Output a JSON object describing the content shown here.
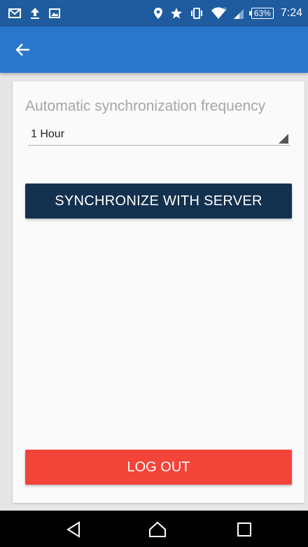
{
  "status_bar": {
    "left_icons": [
      "gmail-icon",
      "upload-icon",
      "image-icon"
    ],
    "right_icons": [
      "location-icon",
      "star-icon",
      "vibrate-icon",
      "wifi-icon",
      "signal-icon"
    ],
    "battery": "63%",
    "time": "7:24",
    "background": "#1f5c9f"
  },
  "app_bar": {
    "back_icon": "arrow-left-icon",
    "background": "#2a76cb"
  },
  "settings": {
    "frequency_label": "Automatic synchronization frequency",
    "frequency_value": "1 Hour",
    "sync_button": "SYNCHRONIZE WITH SERVER",
    "logout_button": "LOG OUT",
    "sync_color": "#14304f",
    "logout_color": "#f3443a"
  },
  "nav_bar": {
    "icons": [
      "back-triangle-icon",
      "home-icon",
      "recents-icon"
    ]
  }
}
